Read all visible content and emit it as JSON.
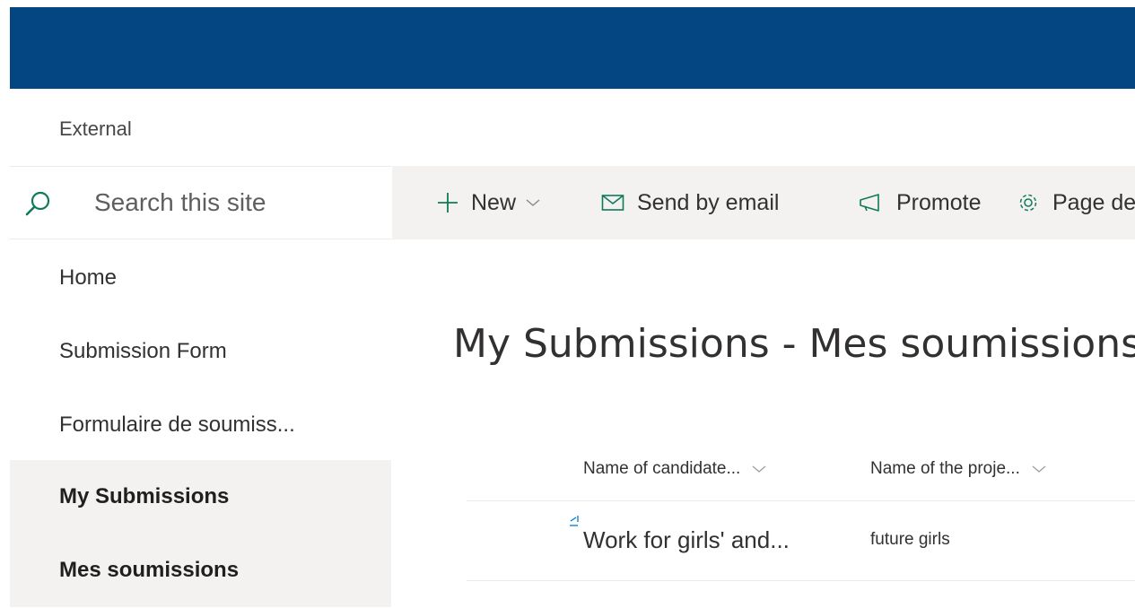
{
  "site": {
    "name": "External"
  },
  "search": {
    "placeholder": "Search this site"
  },
  "nav": {
    "items": [
      {
        "label": "Home"
      },
      {
        "label": "Submission Form"
      },
      {
        "label": "Formulaire de soumiss..."
      },
      {
        "label": "My Submissions"
      },
      {
        "label": "Mes soumissions"
      }
    ],
    "selected_index": 3
  },
  "command_bar": {
    "new_label": "New",
    "send_label": "Send by email",
    "promote_label": "Promote",
    "page_details_label": "Page details"
  },
  "page": {
    "title": "My Submissions -  Mes soumissions"
  },
  "list": {
    "columns": [
      "Name of candidate...",
      "Name of the proje..."
    ],
    "rows": [
      {
        "title": "Work for girls' and...",
        "project": "future girls"
      }
    ]
  },
  "colors": {
    "suite_bar": "#034681",
    "nav_selected_bg": "#f3f2f1",
    "command_bar_bg": "#f3f2f1",
    "accent_icon": "#0f7a5a"
  }
}
